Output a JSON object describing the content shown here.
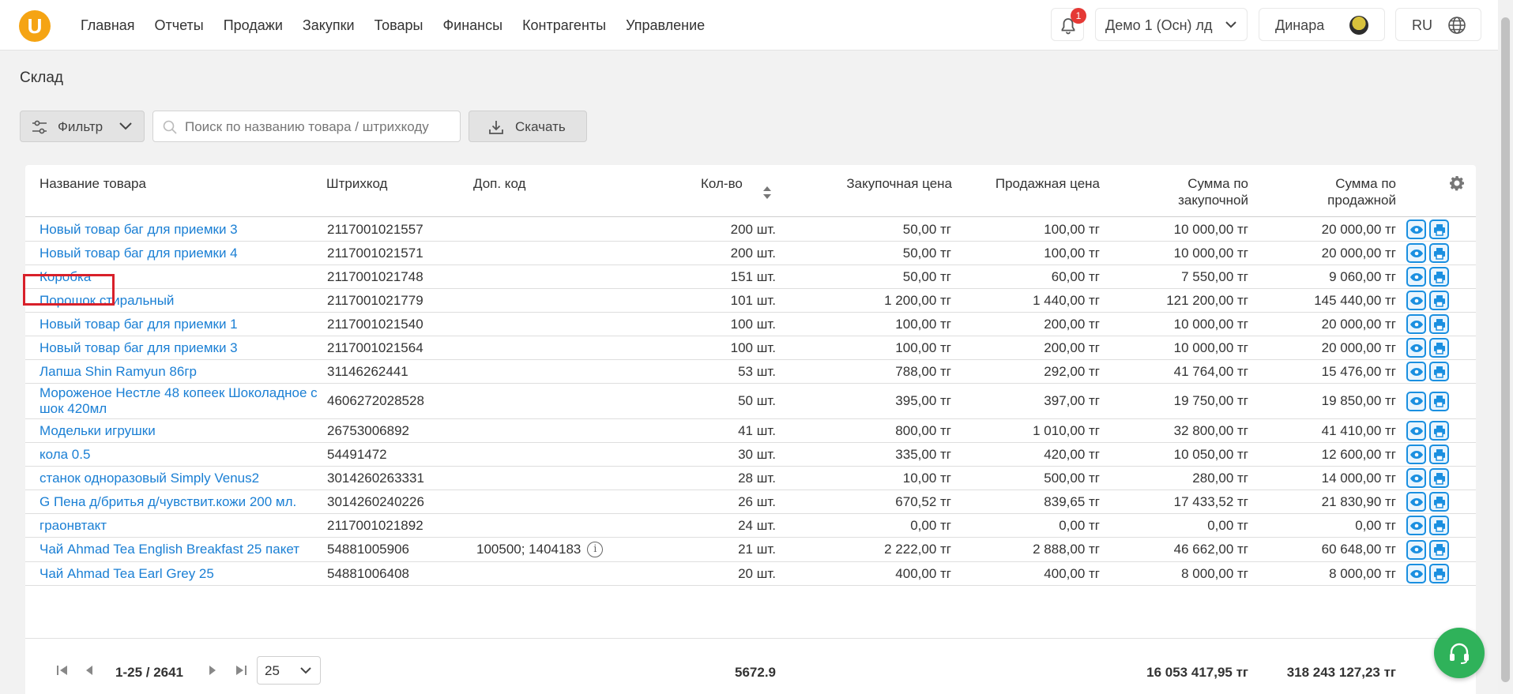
{
  "app": {
    "logo_letter": "U"
  },
  "nav": [
    "Главная",
    "Отчеты",
    "Продажи",
    "Закупки",
    "Товары",
    "Финансы",
    "Контрагенты",
    "Управление"
  ],
  "notifications": {
    "count": "1"
  },
  "store_select": {
    "value": "Демо 1 (Осн) лд"
  },
  "user": {
    "name": "Динара"
  },
  "lang": {
    "value": "RU"
  },
  "page": {
    "title": "Склад"
  },
  "toolbar": {
    "filter_label": "Фильтр",
    "search_placeholder": "Поиск по названию товара / штрихкоду",
    "download_label": "Скачать"
  },
  "table": {
    "headers": {
      "name": "Название товара",
      "barcode": "Штрихкод",
      "extra_code": "Доп. код",
      "qty": "Кол-во",
      "buy_price": "Закупочная цена",
      "sell_price": "Продажная цена",
      "sum_buy_1": "Сумма по",
      "sum_buy_2": "закупочной",
      "sum_sell_1": "Сумма по",
      "sum_sell_2": "продажной"
    },
    "rows": [
      {
        "name": "Новый товар баг для приемки 3",
        "barcode": "2117001021557",
        "extra": "",
        "qty": "200 шт.",
        "buy": "50,00 тг",
        "sell": "100,00 тг",
        "sum_buy": "10 000,00 тг",
        "sum_sell": "20 000,00 тг"
      },
      {
        "name": "Новый товар баг для приемки 4",
        "barcode": "2117001021571",
        "extra": "",
        "qty": "200 шт.",
        "buy": "50,00 тг",
        "sell": "100,00 тг",
        "sum_buy": "10 000,00 тг",
        "sum_sell": "20 000,00 тг"
      },
      {
        "name": "Коробка",
        "barcode": "2117001021748",
        "extra": "",
        "qty": "151 шт.",
        "buy": "50,00 тг",
        "sell": "60,00 тг",
        "sum_buy": "7 550,00 тг",
        "sum_sell": "9 060,00 тг"
      },
      {
        "name": "Порошок стиральный",
        "barcode": "2117001021779",
        "extra": "",
        "qty": "101 шт.",
        "buy": "1 200,00 тг",
        "sell": "1 440,00 тг",
        "sum_buy": "121 200,00 тг",
        "sum_sell": "145 440,00 тг"
      },
      {
        "name": "Новый товар баг для приемки 1",
        "barcode": "2117001021540",
        "extra": "",
        "qty": "100 шт.",
        "buy": "100,00 тг",
        "sell": "200,00 тг",
        "sum_buy": "10 000,00 тг",
        "sum_sell": "20 000,00 тг"
      },
      {
        "name": "Новый товар баг для приемки 3",
        "barcode": "2117001021564",
        "extra": "",
        "qty": "100 шт.",
        "buy": "100,00 тг",
        "sell": "200,00 тг",
        "sum_buy": "10 000,00 тг",
        "sum_sell": "20 000,00 тг"
      },
      {
        "name": "Лапша Shin Ramyun 86гр",
        "barcode": "31146262441",
        "extra": "",
        "qty": "53 шт.",
        "buy": "788,00 тг",
        "sell": "292,00 тг",
        "sum_buy": "41 764,00 тг",
        "sum_sell": "15 476,00 тг"
      },
      {
        "name": "Мороженое Нестле 48 копеек Шоколадное с шок 420мл",
        "barcode": "4606272028528",
        "extra": "",
        "qty": "50 шт.",
        "buy": "395,00 тг",
        "sell": "397,00 тг",
        "sum_buy": "19 750,00 тг",
        "sum_sell": "19 850,00 тг"
      },
      {
        "name": "Модельки игрушки",
        "barcode": "26753006892",
        "extra": "",
        "qty": "41 шт.",
        "buy": "800,00 тг",
        "sell": "1 010,00 тг",
        "sum_buy": "32 800,00 тг",
        "sum_sell": "41 410,00 тг"
      },
      {
        "name": "кола 0.5",
        "barcode": "54491472",
        "extra": "",
        "qty": "30 шт.",
        "buy": "335,00 тг",
        "sell": "420,00 тг",
        "sum_buy": "10 050,00 тг",
        "sum_sell": "12 600,00 тг"
      },
      {
        "name": "станок одноразовый Simply Venus2",
        "barcode": "3014260263331",
        "extra": "",
        "qty": "28 шт.",
        "buy": "10,00 тг",
        "sell": "500,00 тг",
        "sum_buy": "280,00 тг",
        "sum_sell": "14 000,00 тг"
      },
      {
        "name": "G Пена д/бритья д/чувствит.кожи 200 мл.",
        "barcode": "3014260240226",
        "extra": "",
        "qty": "26 шт.",
        "buy": "670,52 тг",
        "sell": "839,65 тг",
        "sum_buy": "17 433,52 тг",
        "sum_sell": "21 830,90 тг"
      },
      {
        "name": "граонвтакт",
        "barcode": "2117001021892",
        "extra": "",
        "qty": "24 шт.",
        "buy": "0,00 тг",
        "sell": "0,00 тг",
        "sum_buy": "0,00 тг",
        "sum_sell": "0,00 тг"
      },
      {
        "name": "Чай Ahmad Tea English Breakfast 25 пакет",
        "barcode": "54881005906",
        "extra": "100500; 1404183",
        "qty": "21 шт.",
        "buy": "2 222,00 тг",
        "sell": "2 888,00 тг",
        "sum_buy": "46 662,00 тг",
        "sum_sell": "60 648,00 тг"
      },
      {
        "name": "Чай Ahmad Tea Earl Grey 25",
        "barcode": "54881006408",
        "extra": "",
        "qty": "20 шт.",
        "buy": "400,00 тг",
        "sell": "400,00 тг",
        "sum_buy": "8 000,00 тг",
        "sum_sell": "8 000,00 тг"
      }
    ]
  },
  "footer": {
    "pagination": "1-25 / 2641",
    "per_page": "25",
    "total_qty": "5672.9",
    "total_buy": "16 053 417,95 тг",
    "total_sell": "318 243 127,23 тг"
  },
  "colors": {
    "accent": "#f5a413",
    "link": "#1a7fd4",
    "support": "#2fb25a",
    "highlight": "#d8202a"
  }
}
